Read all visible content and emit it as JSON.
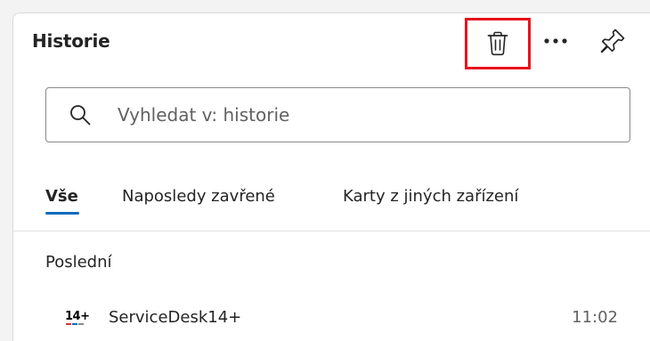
{
  "panel": {
    "title": "Historie"
  },
  "toolbar": {
    "delete_icon": "trash-icon",
    "more_icon": "more-horizontal-icon",
    "pin_icon": "pin-icon",
    "highlight_color": "#e8121b"
  },
  "search": {
    "placeholder": "Vyhledat v: historie",
    "value": ""
  },
  "tabs": [
    {
      "label": "Vše",
      "selected": true
    },
    {
      "label": "Naposledy zavřené",
      "selected": false
    },
    {
      "label": "Karty z jiných zařízení",
      "selected": false
    }
  ],
  "accent_color": "#0f6cbd",
  "sections": [
    {
      "title": "Poslední",
      "items": [
        {
          "favicon_text": "14+",
          "title": "ServiceDesk14+",
          "time": "11:02"
        }
      ]
    }
  ]
}
